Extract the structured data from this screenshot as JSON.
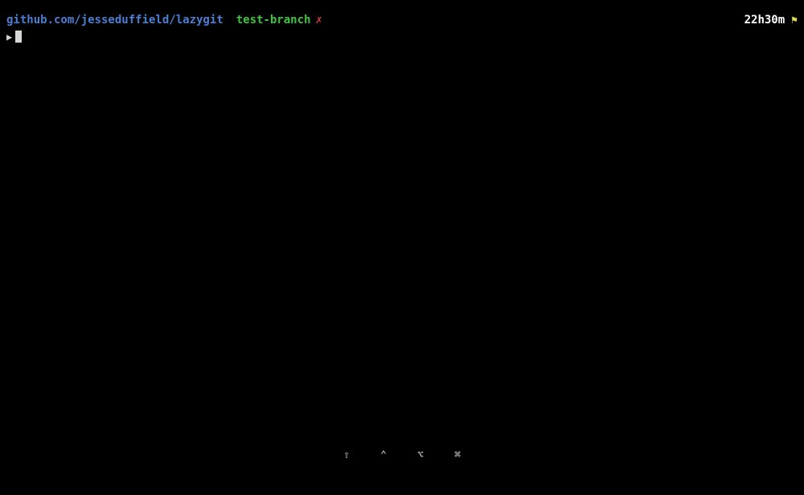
{
  "status": {
    "repo_path": "github.com/jesseduffield/lazygit",
    "branch_name": "test-branch",
    "dirty_symbol": "✗",
    "time": "22h30m",
    "flag_glyph": "⚑"
  },
  "prompt": {
    "symbol": "▶"
  },
  "modifiers": {
    "shift": "⇧",
    "ctrl": "⌃",
    "option": "⌥",
    "command": "⌘"
  }
}
